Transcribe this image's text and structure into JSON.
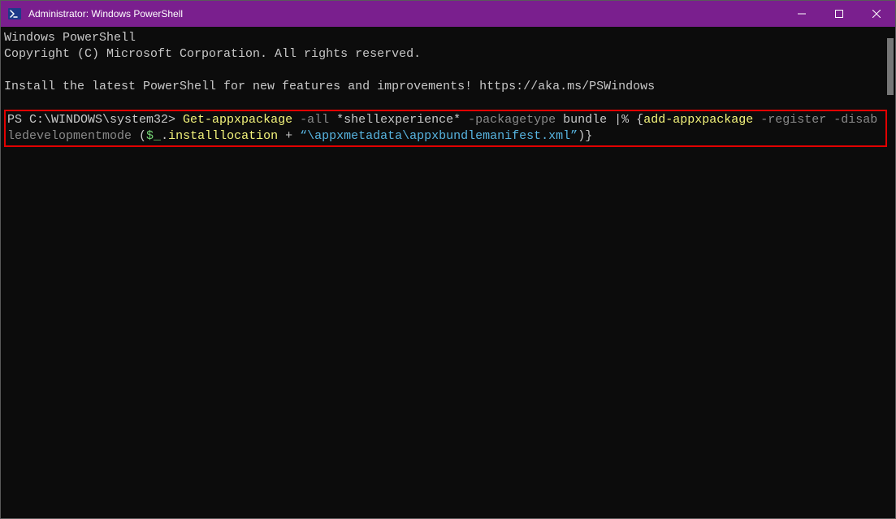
{
  "titlebar": {
    "title": "Administrator: Windows PowerShell"
  },
  "terminal": {
    "banner1": "Windows PowerShell",
    "banner2": "Copyright (C) Microsoft Corporation. All rights reserved.",
    "install_msg": "Install the latest PowerShell for new features and improvements! https://aka.ms/PSWindows",
    "prompt": "PS C:\\WINDOWS\\system32> ",
    "cmd": {
      "get": "Get-appxpackage",
      "p_all": " -all ",
      "v_shell": "*shellexperience*",
      "p_pkgtype": " -packagetype ",
      "v_bundle": "bundle ",
      "pipe": "|% {",
      "add": "add-appxpackage",
      "p_register": " -register ",
      "p_disabledev": "-disabledevelopmentmode ",
      "open_paren": "(",
      "var": "$_",
      "dot": ".",
      "prop": "installlocation",
      "plus": " + ",
      "str": "“\\appxmetadata\\appxbundlemanifest.xml”",
      "close": ")}"
    }
  }
}
